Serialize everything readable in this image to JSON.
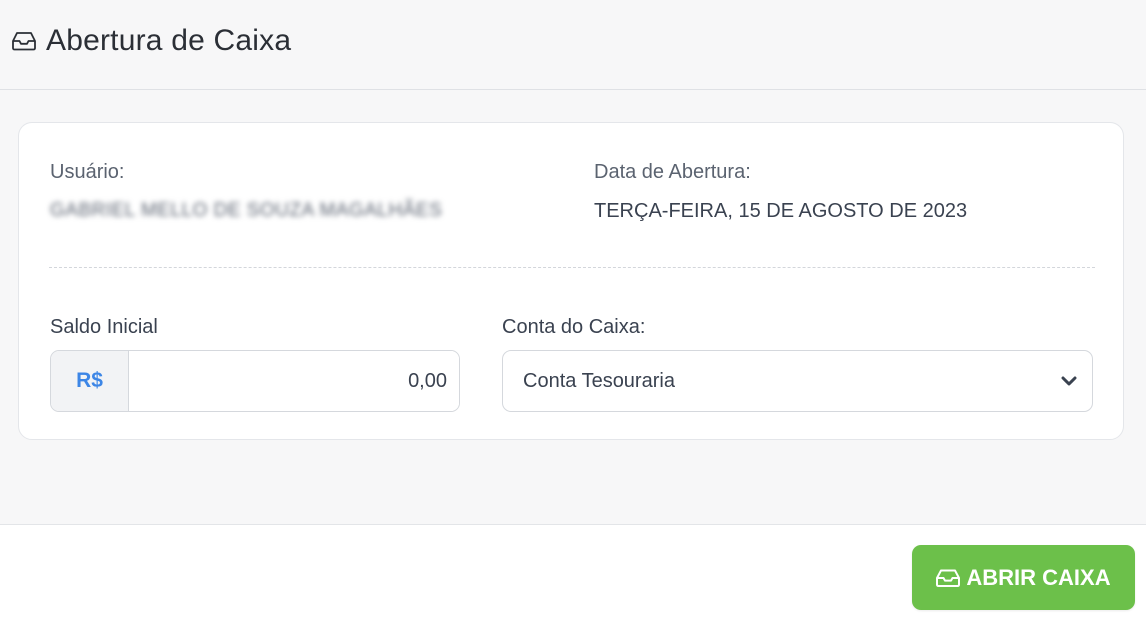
{
  "header": {
    "icon": "inbox-tray-icon",
    "title": "Abertura de Caixa"
  },
  "info": {
    "user_label": "Usuário:",
    "user_value": "GABRIEL MELLO DE SOUZA MAGALHÃES",
    "user_value_obscured": true,
    "date_label": "Data de Abertura:",
    "date_value": "TERÇA-FEIRA, 15 DE AGOSTO DE 2023"
  },
  "form": {
    "saldo_label": "Saldo Inicial",
    "currency_prefix": "R$",
    "saldo_value": "0,00",
    "conta_label": "Conta do Caixa:",
    "conta_selected": "Conta Tesouraria"
  },
  "footer": {
    "open_button_icon": "inbox-tray-icon",
    "open_button_label": "ABRIR CAIXA"
  },
  "colors": {
    "accent_green": "#6cc04a",
    "currency_blue": "#3d86e6",
    "panel_background": "#f7f7f8"
  }
}
